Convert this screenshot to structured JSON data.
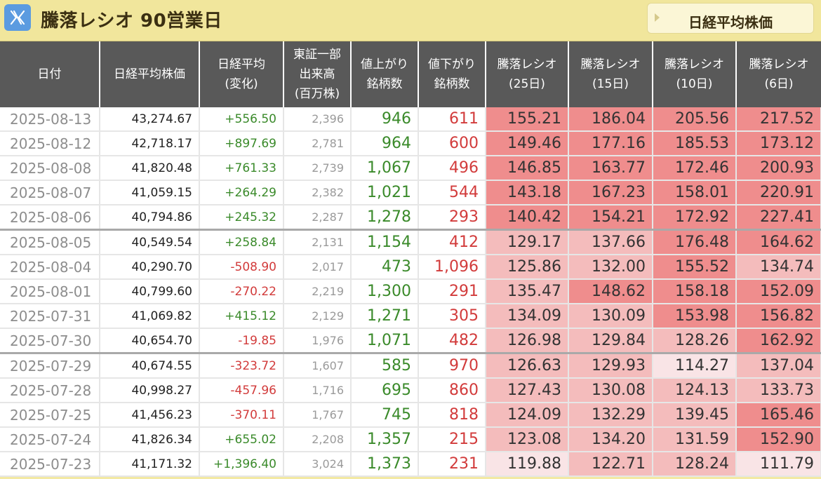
{
  "header": {
    "title": "騰落レシオ 90営業日",
    "nav_label": "日経平均株価"
  },
  "table": {
    "columns": [
      [
        "日付"
      ],
      [
        "日経平均株価"
      ],
      [
        "日経平均",
        "(変化)"
      ],
      [
        "東証一部",
        "出来高",
        "(百万株)"
      ],
      [
        "値上がり",
        "銘柄数"
      ],
      [
        "値下がり",
        "銘柄数"
      ],
      [
        "騰落レシオ",
        "(25日)"
      ],
      [
        "騰落レシオ",
        "(15日)"
      ],
      [
        "騰落レシオ",
        "(10日)"
      ],
      [
        "騰落レシオ",
        "(6日)"
      ]
    ],
    "rows": [
      {
        "date": "2025-08-13",
        "nikkei": "43,274.67",
        "change": "+556.50",
        "volume": "2,396",
        "advancers": "946",
        "decliners": "611",
        "r25": "155.21",
        "r15": "186.04",
        "r10": "205.56",
        "r6": "217.52"
      },
      {
        "date": "2025-08-12",
        "nikkei": "42,718.17",
        "change": "+897.69",
        "volume": "2,781",
        "advancers": "964",
        "decliners": "600",
        "r25": "149.46",
        "r15": "177.16",
        "r10": "185.53",
        "r6": "173.12"
      },
      {
        "date": "2025-08-08",
        "nikkei": "41,820.48",
        "change": "+761.33",
        "volume": "2,739",
        "advancers": "1,067",
        "decliners": "496",
        "r25": "146.85",
        "r15": "163.77",
        "r10": "172.46",
        "r6": "200.93"
      },
      {
        "date": "2025-08-07",
        "nikkei": "41,059.15",
        "change": "+264.29",
        "volume": "2,382",
        "advancers": "1,021",
        "decliners": "544",
        "r25": "143.18",
        "r15": "167.23",
        "r10": "158.01",
        "r6": "220.91"
      },
      {
        "date": "2025-08-06",
        "nikkei": "40,794.86",
        "change": "+245.32",
        "volume": "2,287",
        "advancers": "1,278",
        "decliners": "293",
        "r25": "140.42",
        "r15": "154.21",
        "r10": "172.92",
        "r6": "227.41"
      },
      {
        "date": "2025-08-05",
        "nikkei": "40,549.54",
        "change": "+258.84",
        "volume": "2,131",
        "advancers": "1,154",
        "decliners": "412",
        "r25": "129.17",
        "r15": "137.66",
        "r10": "176.48",
        "r6": "164.62"
      },
      {
        "date": "2025-08-04",
        "nikkei": "40,290.70",
        "change": "-508.90",
        "volume": "2,017",
        "advancers": "473",
        "decliners": "1,096",
        "r25": "125.86",
        "r15": "132.00",
        "r10": "155.52",
        "r6": "134.74"
      },
      {
        "date": "2025-08-01",
        "nikkei": "40,799.60",
        "change": "-270.22",
        "volume": "2,219",
        "advancers": "1,300",
        "decliners": "291",
        "r25": "135.47",
        "r15": "148.62",
        "r10": "158.18",
        "r6": "152.09"
      },
      {
        "date": "2025-07-31",
        "nikkei": "41,069.82",
        "change": "+415.12",
        "volume": "2,129",
        "advancers": "1,271",
        "decliners": "305",
        "r25": "134.09",
        "r15": "130.09",
        "r10": "153.98",
        "r6": "156.82"
      },
      {
        "date": "2025-07-30",
        "nikkei": "40,654.70",
        "change": "-19.85",
        "volume": "1,976",
        "advancers": "1,071",
        "decliners": "482",
        "r25": "126.98",
        "r15": "129.84",
        "r10": "128.26",
        "r6": "162.92"
      },
      {
        "date": "2025-07-29",
        "nikkei": "40,674.55",
        "change": "-323.72",
        "volume": "1,607",
        "advancers": "585",
        "decliners": "970",
        "r25": "126.63",
        "r15": "129.93",
        "r10": "114.27",
        "r6": "137.04"
      },
      {
        "date": "2025-07-28",
        "nikkei": "40,998.27",
        "change": "-457.96",
        "volume": "1,716",
        "advancers": "695",
        "decliners": "860",
        "r25": "127.43",
        "r15": "130.08",
        "r10": "124.13",
        "r6": "133.73"
      },
      {
        "date": "2025-07-25",
        "nikkei": "41,456.23",
        "change": "-370.11",
        "volume": "1,767",
        "advancers": "745",
        "decliners": "818",
        "r25": "124.09",
        "r15": "132.29",
        "r10": "139.45",
        "r6": "165.46"
      },
      {
        "date": "2025-07-24",
        "nikkei": "41,826.34",
        "change": "+655.02",
        "volume": "2,208",
        "advancers": "1,357",
        "decliners": "215",
        "r25": "123.08",
        "r15": "134.20",
        "r10": "131.59",
        "r6": "152.90"
      },
      {
        "date": "2025-07-23",
        "nikkei": "41,171.32",
        "change": "+1,396.40",
        "volume": "3,024",
        "advancers": "1,373",
        "decliners": "231",
        "r25": "119.88",
        "r15": "122.71",
        "r10": "128.24",
        "r6": "111.79"
      }
    ]
  },
  "colors": {
    "header_bg": "#f1e69c",
    "table_header_bg": "#595959",
    "up": "#3a8a2a",
    "down": "#d23b3b",
    "hot": "#ef8d8d",
    "warm": "#f4bcbc",
    "cool": "#f9e4e6"
  }
}
